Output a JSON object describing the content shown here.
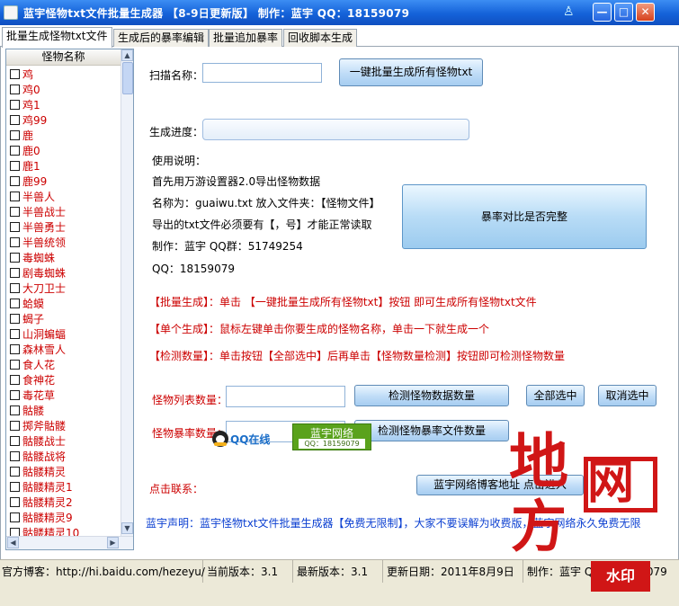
{
  "window": {
    "title": "蓝宇怪物txt文件批量生成器 【8-9日更新版】 制作：蓝宇 QQ：18159079",
    "pin_glyph": "♙",
    "min_glyph": "—",
    "max_glyph": "□",
    "close_glyph": "✕"
  },
  "tabs": [
    {
      "label": "批量生成怪物txt文件"
    },
    {
      "label": "生成后的暴率编辑"
    },
    {
      "label": "批量追加暴率"
    },
    {
      "label": "回收脚本生成"
    }
  ],
  "monster_list": {
    "header": "怪物名称",
    "items": [
      "鸡",
      "鸡0",
      "鸡1",
      "鸡99",
      "鹿",
      "鹿0",
      "鹿1",
      "鹿99",
      "半兽人",
      "半兽战士",
      "半兽勇士",
      "半兽统领",
      "毒蜘蛛",
      "剧毒蜘蛛",
      "大刀卫士",
      "蛤蟆",
      "蝎子",
      "山洞蝙蝠",
      "森林雪人",
      "食人花",
      "食神花",
      "毒花草",
      "骷髅",
      "掷斧骷髅",
      "骷髅战士",
      "骷髅战将",
      "骷髅精灵",
      "骷髅精灵1",
      "骷髅精灵2",
      "骷髅精灵9",
      "骷髅精灵10"
    ],
    "up_arrow": "▲",
    "down_arrow": "▼",
    "left_arrow": "◀",
    "right_arrow": "▶"
  },
  "scan": {
    "label": "扫描名称：",
    "value": "",
    "generate_all_button": "一键批量生成所有怪物txt"
  },
  "progress": {
    "label": "生成进度：",
    "fraction": 0
  },
  "instructions": {
    "title": "使用说明：",
    "line1": "首先用万游设置器2.0导出怪物数据",
    "line2": "名称为：guaiwu.txt  放入文件夹：【怪物文件】",
    "line3": "导出的txt文件必须要有【，号】才能正常读取",
    "line4": "制作：蓝宇    QQ群：51749254",
    "line5": "QQ：18159079"
  },
  "compare_button": "暴率对比是否完整",
  "help": {
    "batch": "【批量生成】：单击 【一键批量生成所有怪物txt】按钮 即可生成所有怪物txt文件",
    "single": "【单个生成】：鼠标左键单击你要生成的怪物名称，单击一下就生成一个",
    "detect": "【检测数量】：单击按钮【全部选中】后再单击【怪物数量检测】按钮即可检测怪物数量"
  },
  "counts": {
    "list_label": "怪物列表数量：",
    "list_value": "",
    "detect_list_button": "检测怪物数据数量",
    "select_all_button": "全部选中",
    "deselect_button": "取消选中",
    "rate_label": "怪物暴率数量：",
    "rate_value": "",
    "detect_rate_button": "检测怪物暴率文件数量"
  },
  "contact": {
    "label": "点击联系：",
    "qq_badge": "QQ在线",
    "lanyu_badge_title": "蓝宇网络",
    "lanyu_badge_qq": "QQ：18159079",
    "blog_button": "蓝宇网络博客地址 点击进入"
  },
  "statement": "蓝宇声明：蓝宇怪物txt文件批量生成器【免费无限制】，大家不要误解为收费版，蓝宇网络永久免费无限",
  "status": {
    "blog": "官方博客：http://hi.baidu.com/hezeyu/",
    "current_version": "当前版本：3.1",
    "latest_version": "最新版本：3.1",
    "update_date": "更新日期：2011年8月9日",
    "author": "制作：蓝宇 QQ：18159079"
  },
  "watermark": {
    "char1": "地",
    "char2": "方",
    "char3": "网",
    "seal": "水印"
  },
  "colors": {
    "title_blue": "#1462d9",
    "help_red": "#cc0000",
    "statement_blue": "#0b3fd1",
    "watermark_red": "#d01616"
  }
}
